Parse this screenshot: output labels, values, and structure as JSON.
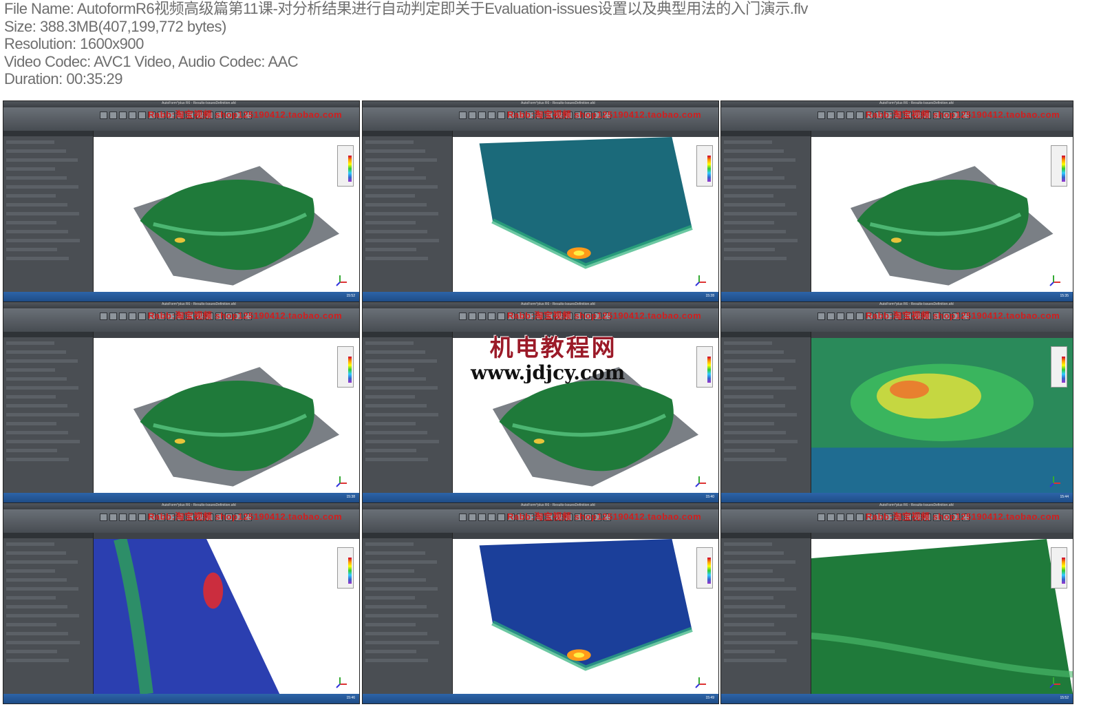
{
  "meta": {
    "file_name": "File Name: AutoformR6视频高级篇第11课-对分析结果进行自动判定即关于Evaluation-issues设置以及典型用法的入门演示.flv",
    "size": "Size: 388.3MB(407,199,772 bytes)",
    "resolution": "Resolution: 1600x900",
    "codec": "Video Codec: AVC1 Video, Audio Codec: AAC",
    "duration": "Duration: 00:35:29"
  },
  "thumb_title": "AutoForm^plus R6 - Results-IssuesDefinition.afd",
  "thumb_watermark": "Rabb:淘宝视频 shop125190412.taobao.com",
  "overlay": {
    "site_cn": "机电教程网",
    "site_url": "www.jdjcy.com"
  },
  "thumbnails": [
    {
      "time": "15:52",
      "shape": "hood",
      "fill": "#1f7a3a",
      "base": true
    },
    {
      "time": "15:28",
      "shape": "hoodtilt",
      "fill": "#1b6a7a",
      "base": false
    },
    {
      "time": "15:35",
      "shape": "hood",
      "fill": "#1f7a3a",
      "base": true
    },
    {
      "time": "15:38",
      "shape": "hood",
      "fill": "#1f7a3a",
      "base": true
    },
    {
      "time": "15:40",
      "shape": "hood",
      "fill": "#1f7a3a",
      "base": true
    },
    {
      "time": "15:44",
      "shape": "contour",
      "fill": "#2a8a5a",
      "base": false
    },
    {
      "time": "15:46",
      "shape": "zoom",
      "fill": "#2b3fb0",
      "base": false
    },
    {
      "time": "15:49",
      "shape": "hoodtilt",
      "fill": "#1b3f9a",
      "base": false
    },
    {
      "time": "15:52",
      "shape": "green",
      "fill": "#1f7a3a",
      "base": false
    }
  ],
  "colors": {
    "status": "#2d64a8",
    "watermark": "#d21e1e",
    "overlay": "#9b1a28"
  }
}
